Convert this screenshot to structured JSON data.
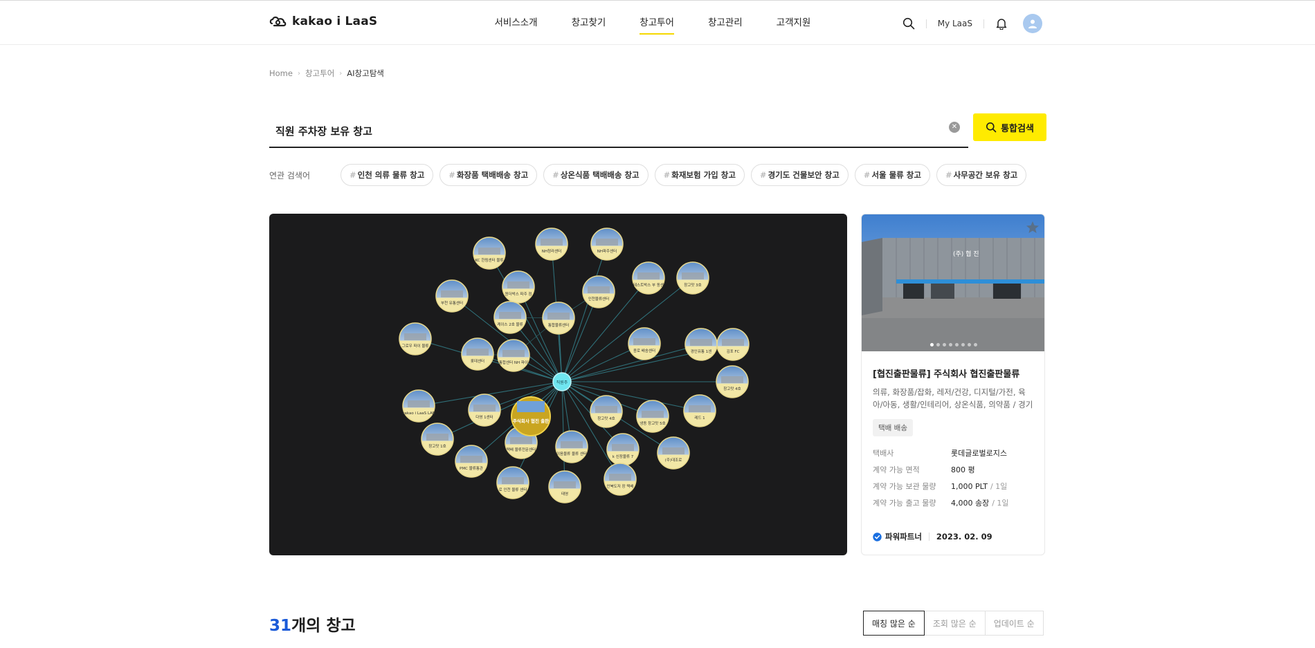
{
  "header": {
    "logo_text": "kakao i LaaS",
    "nav": [
      {
        "label": "서비스소개",
        "active": false
      },
      {
        "label": "창고찾기",
        "active": false
      },
      {
        "label": "창고투어",
        "active": true
      },
      {
        "label": "창고관리",
        "active": false
      },
      {
        "label": "고객지원",
        "active": false
      }
    ],
    "my_laas": "My LaaS",
    "icons": [
      "search-icon",
      "bell-icon",
      "user-avatar-icon"
    ]
  },
  "breadcrumb": [
    "Home",
    "창고투어",
    "AI창고탐색"
  ],
  "search": {
    "value": "직원 주차장 보유 창고",
    "button_label": "통합검색"
  },
  "related": {
    "label": "연관 검색어",
    "tags": [
      "인천 의류 물류 창고",
      "화장품 택배배송 창고",
      "상온식품 택배배송 창고",
      "화재보험 가입 창고",
      "경기도 건물보안 창고",
      "서울 물류 창고",
      "사무공간 보유 창고"
    ]
  },
  "graph": {
    "center_label": "직원주",
    "accent": "#6fe6f0",
    "node_labels": [
      "KC 한림센터 물류",
      "NH청라센터",
      "NH파주센터",
      "테스트박스 부 동센",
      "원더박스 파주 점",
      "인천물류센터",
      "창고맛 3호",
      "부천 유통센터",
      "케이스 2호 물류",
      "통합물류센터",
      "종로 배송센터",
      "그로우 파이 물류",
      "통합센터 NH 파이",
      "롯데센터",
      "경인유통 1센",
      "김포 FC",
      "창고맛 4호",
      "kakao i LaaS LAB",
      "다영 1센터",
      "창고맛 4호",
      "냉동 창고맛 5호",
      "레드 1",
      "창고맛 1호",
      "택배 물류전문센터",
      "이음물류 물류 센터",
      "k 신장물류 7",
      "(주)대조로",
      "PMC 물류통관",
      "로 인천 물류 센터",
      "태영",
      "인북도저 장 택배"
    ]
  },
  "featured": {
    "title": "[협진출판물류] 주식회사 협진출판물류",
    "highlight_node": "주식회사 협진 출판",
    "building_sign": "(주) 협 진",
    "categories": "의류, 화장품/잡화, 레저/건강, 디지털/가전, 육아/아동, 생활/인테리어, 상온식품, 의약품 / 경기도...",
    "badge": "택배 배송",
    "info": [
      {
        "key": "택배사",
        "value": "롯데글로벌로지스",
        "unit": ""
      },
      {
        "key": "계약 가능 면적",
        "value": "800 평",
        "unit": ""
      },
      {
        "key": "계약 가능 보관 물량",
        "value": "1,000 PLT",
        "unit": "/ 1일"
      },
      {
        "key": "계약 가능 출고 물량",
        "value": "4,000 송장",
        "unit": "/ 1일"
      }
    ],
    "partner": "파워파트너",
    "date": "2023. 02. 09",
    "slide_count": 8,
    "slide_active": 1
  },
  "results": {
    "count": "31",
    "suffix": "개의 창고",
    "sort": [
      {
        "label": "매칭 많은 순",
        "active": true
      },
      {
        "label": "조회 많은 순",
        "active": false
      },
      {
        "label": "업데이트 순",
        "active": false
      }
    ]
  }
}
